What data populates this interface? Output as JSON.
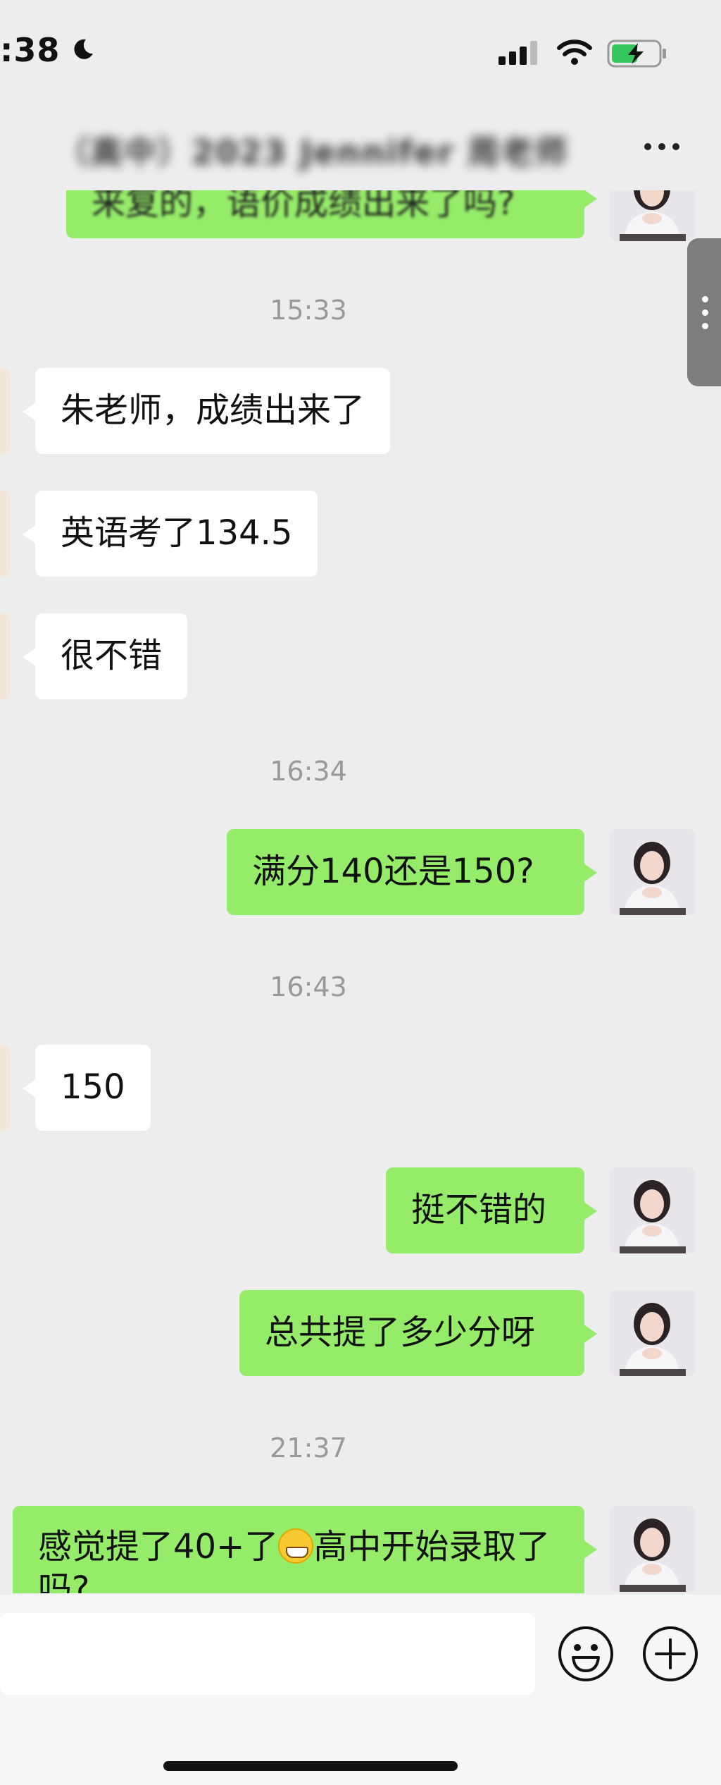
{
  "status_bar": {
    "time": ":38",
    "icons": [
      "moon-icon",
      "signal-icon",
      "wifi-icon",
      "battery-charging-icon"
    ]
  },
  "nav": {
    "title": "（高中）2023 Jennifer 周老师",
    "more_icon": "more-dots-icon"
  },
  "messages": [
    {
      "type": "out",
      "text": "来复的，语价成绩出来了吗?"
    },
    {
      "type": "time",
      "text": "15:33"
    },
    {
      "type": "in",
      "text": "朱老师，成绩出来了"
    },
    {
      "type": "in",
      "text": "英语考了134.5"
    },
    {
      "type": "in",
      "text": "很不错"
    },
    {
      "type": "time",
      "text": "16:34"
    },
    {
      "type": "out",
      "text": "满分140还是150?"
    },
    {
      "type": "time",
      "text": "16:43"
    },
    {
      "type": "in",
      "text": "150"
    },
    {
      "type": "out",
      "text": "挺不错的"
    },
    {
      "type": "out",
      "text": "总共提了多少分呀"
    },
    {
      "type": "time",
      "text": "21:37"
    },
    {
      "type": "out",
      "text_before_emoji": "感觉提了40+了",
      "emoji": "grinning-face-icon",
      "text_after_emoji": "高中开始录取了吗?"
    }
  ],
  "input_bar": {
    "placeholder": "",
    "emoji_icon": "emoji-smile-icon",
    "plus_icon": "plus-circle-icon"
  },
  "colors": {
    "background": "#ededed",
    "outgoing_bubble": "#95ec69",
    "incoming_bubble": "#ffffff",
    "timestamp": "#999999"
  }
}
